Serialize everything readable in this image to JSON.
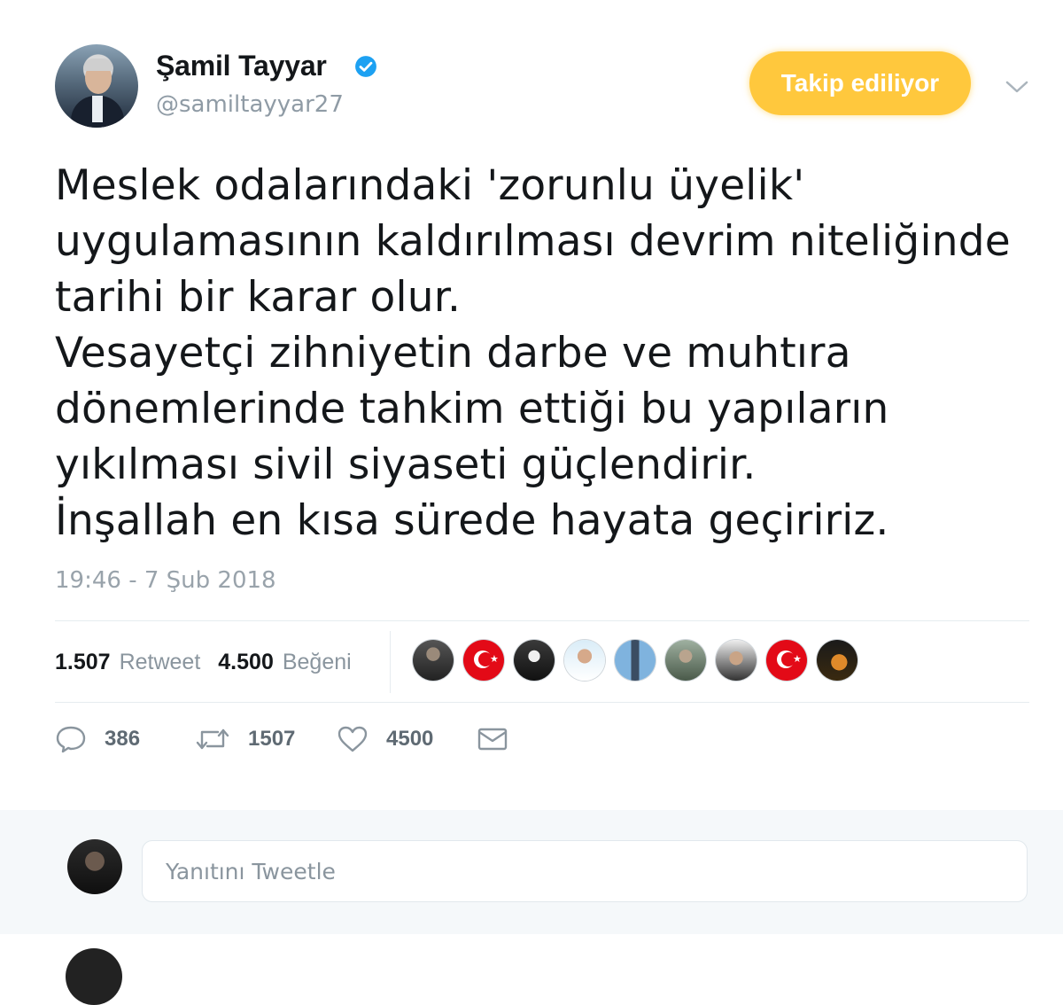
{
  "tweet": {
    "author_name": "Şamil Tayyar",
    "author_handle": "@samiltayyar27",
    "follow_button_label": "Takip ediliyor",
    "text": "Meslek odalarındaki 'zorunlu üyelik'\nuygulamasının kaldırılması devrim niteliğinde\ntarihi bir karar olur.\nVesayetçi zihniyetin darbe ve muhtıra\ndönemlerinde tahkim ettiği bu yapıların\nyıkılması sivil siyaseti güçlendirir.\nİnşallah en kısa sürede hayata geçiririz.",
    "timestamp": "19:46 - 7 Şub 2018"
  },
  "stats": {
    "retweet_count": "1.507",
    "retweet_label": "Retweet",
    "like_count": "4.500",
    "like_label": "Beğeni"
  },
  "actions": {
    "reply_count": "386",
    "retweet_count": "1507",
    "like_count": "4500"
  },
  "reply_box": {
    "placeholder": "Yanıtını Tweetle"
  },
  "colors": {
    "follow_button": "#ffc83d",
    "verified_badge": "#1da1f2",
    "turkish_flag": "#e30a17"
  },
  "icons": [
    "verified-badge-icon",
    "chevron-down-icon",
    "reply-icon",
    "retweet-icon",
    "like-heart-icon",
    "direct-message-icon"
  ]
}
